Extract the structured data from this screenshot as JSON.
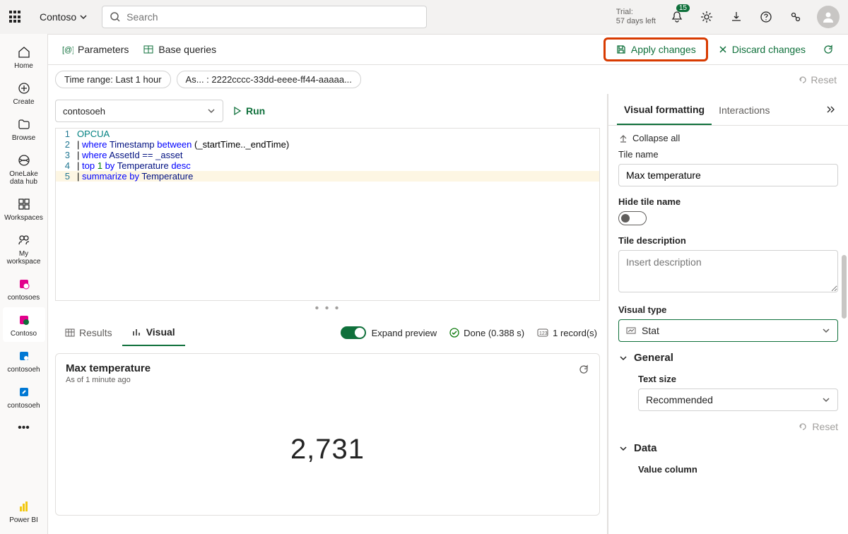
{
  "tenant": "Contoso",
  "search_placeholder": "Search",
  "trial": {
    "label": "Trial:",
    "remaining": "57 days left"
  },
  "notifications_count": "15",
  "left_rail": [
    {
      "label": "Home"
    },
    {
      "label": "Create"
    },
    {
      "label": "Browse"
    },
    {
      "label": "OneLake data hub"
    },
    {
      "label": "Workspaces"
    },
    {
      "label": "My workspace"
    },
    {
      "label": "contosoes"
    },
    {
      "label": "Contoso"
    },
    {
      "label": "contosoeh"
    },
    {
      "label": "contosoeh"
    },
    {
      "label": "Power BI"
    }
  ],
  "toolbar": {
    "parameters": "Parameters",
    "base_queries": "Base queries",
    "apply": "Apply changes",
    "discard": "Discard changes"
  },
  "chips": {
    "time_range": "Time range: Last 1 hour",
    "asset": "As... : 2222cccc-33dd-eeee-ff44-aaaaa...",
    "reset": "Reset"
  },
  "datasource": "contosoeh",
  "run_label": "Run",
  "code": {
    "l1": "OPCUA",
    "l2": "|",
    "l2b": "where",
    "l2c": "Timestamp",
    "l2d": "between",
    "l2e": "(_startTime.._endTime)",
    "l3": "|",
    "l3b": "where",
    "l3c": "AssetId ==",
    "l3d": "_asset",
    "l4": "|",
    "l4b": "top",
    "l4c": "1",
    "l4d": "by",
    "l4e": "Temperature",
    "l4f": "desc",
    "l5": "|",
    "l5b": "summarize",
    "l5c": "by",
    "l5d": "Temperature"
  },
  "results_tabs": {
    "results": "Results",
    "visual": "Visual"
  },
  "expand_preview": "Expand preview",
  "status": "Done (0.388 s)",
  "records": "1 record(s)",
  "tile": {
    "title": "Max temperature",
    "subtitle": "As of 1 minute ago",
    "value": "2,731"
  },
  "rp": {
    "tab_visual": "Visual formatting",
    "tab_interactions": "Interactions",
    "collapse_all": "Collapse all",
    "tile_name_label": "Tile name",
    "tile_name_value": "Max temperature",
    "hide_tile_name": "Hide tile name",
    "tile_desc_label": "Tile description",
    "tile_desc_placeholder": "Insert description",
    "visual_type_label": "Visual type",
    "visual_type_value": "Stat",
    "general": "General",
    "text_size_label": "Text size",
    "text_size_value": "Recommended",
    "reset": "Reset",
    "data": "Data",
    "value_column": "Value column"
  }
}
